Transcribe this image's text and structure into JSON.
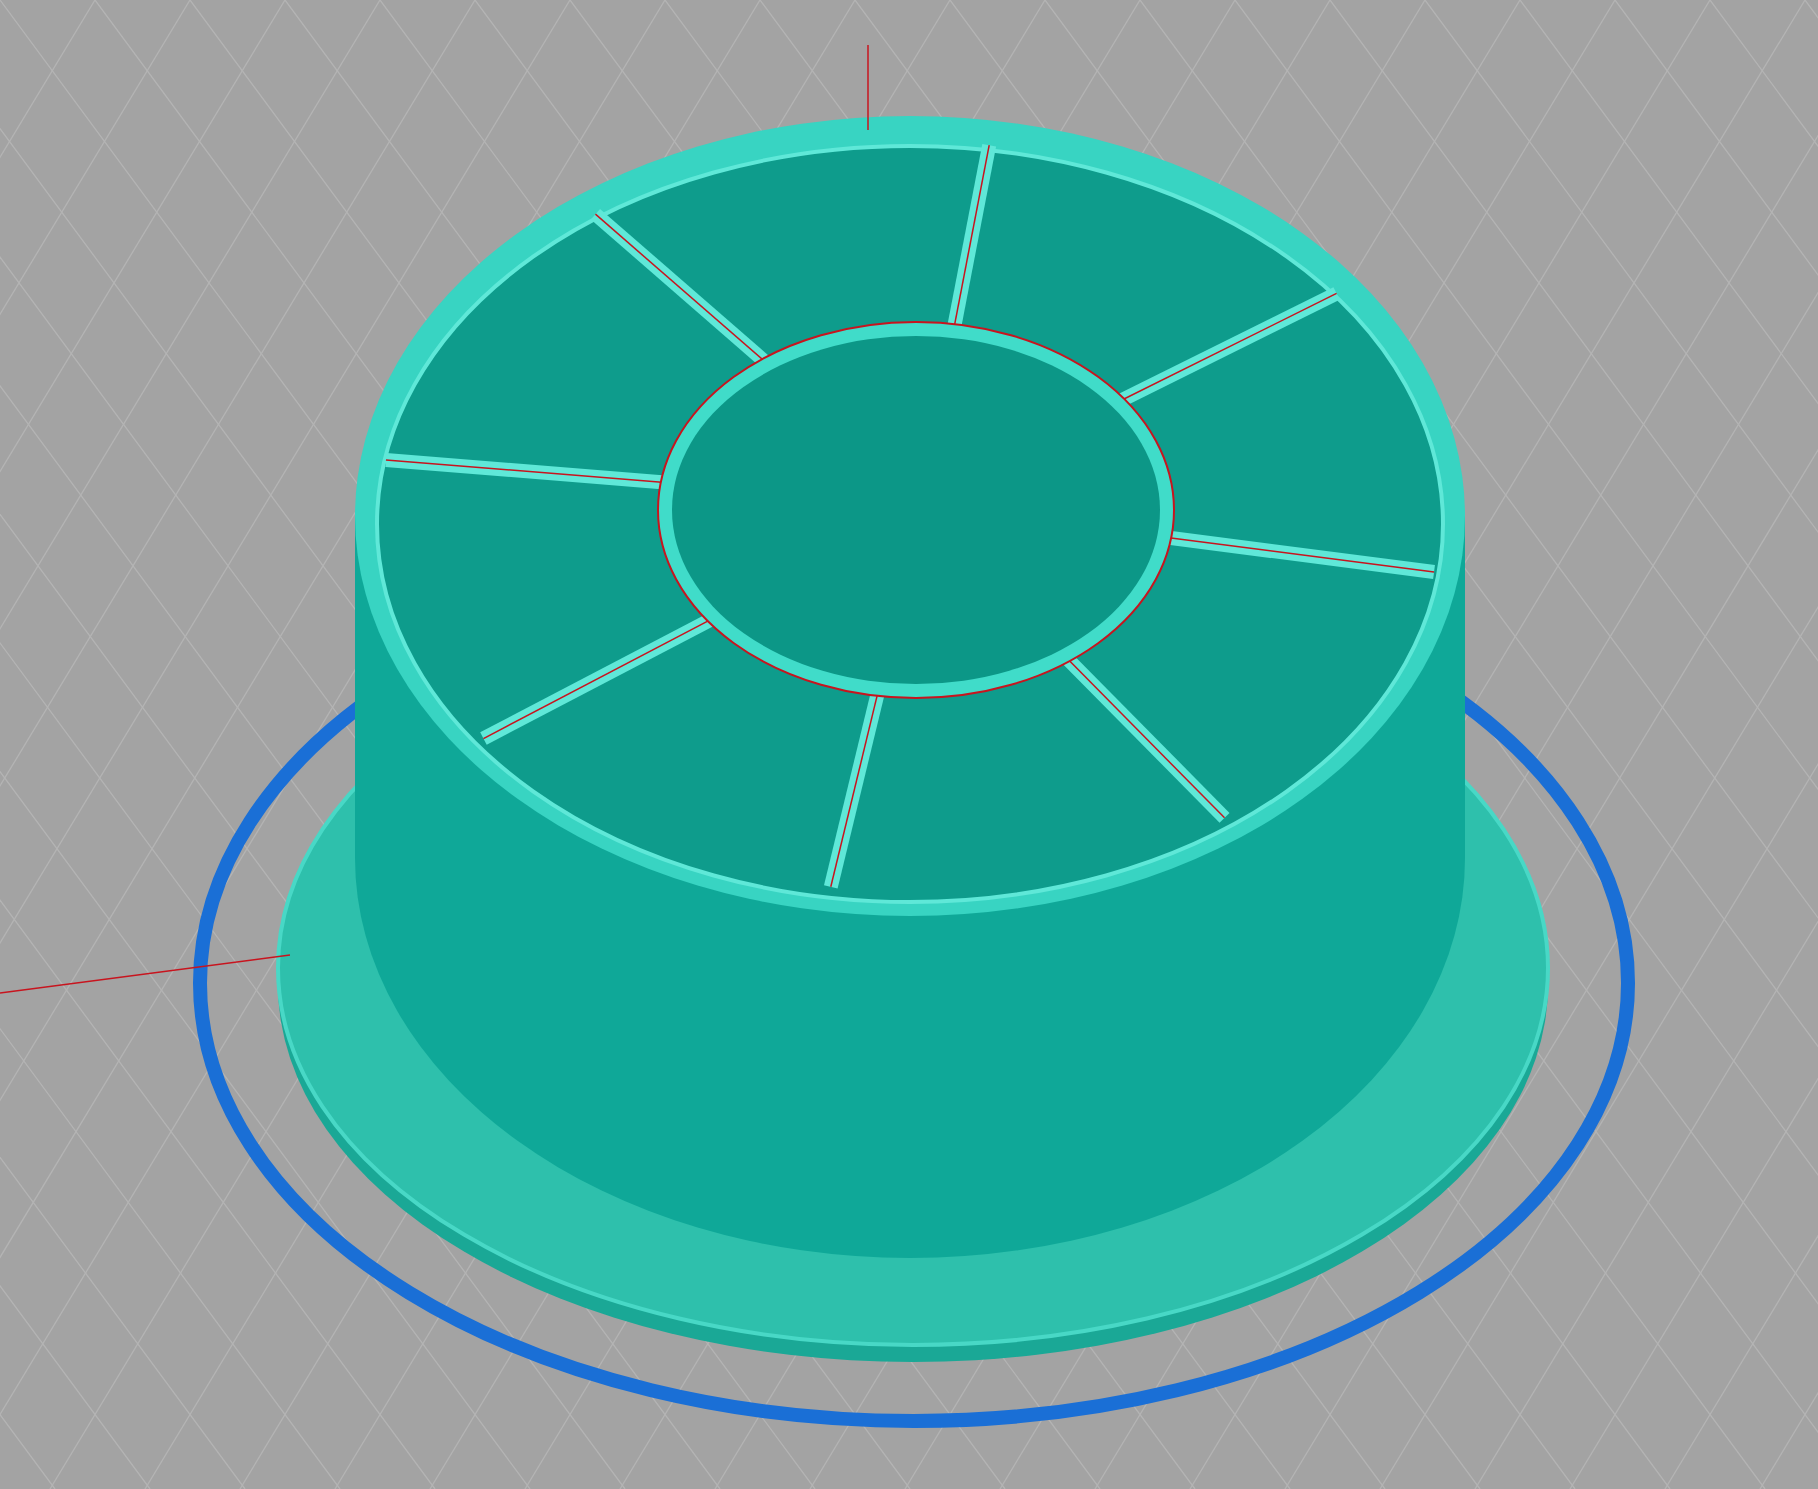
{
  "scene": {
    "kind": "sliced-model-preview"
  }
}
